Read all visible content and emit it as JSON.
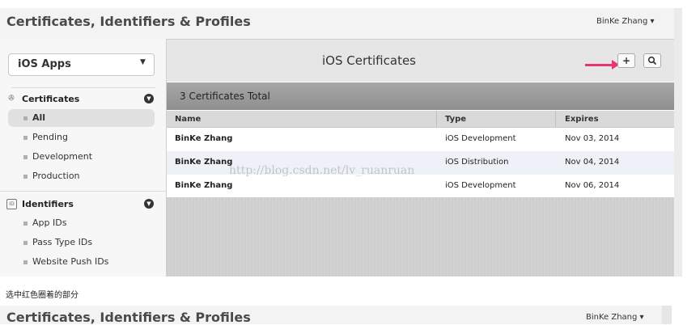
{
  "app": {
    "title": "Certificates, Identifiers & Profiles",
    "user_menu": "BinKe Zhang ▾"
  },
  "sidebar": {
    "platform_select": {
      "selected": "iOS Apps"
    },
    "sections": [
      {
        "title": "Certificates",
        "items": [
          "All",
          "Pending",
          "Development",
          "Production"
        ],
        "active": "All"
      },
      {
        "title": "Identifiers",
        "items": [
          "App IDs",
          "Pass Type IDs",
          "Website Push IDs"
        ]
      }
    ]
  },
  "main": {
    "title": "iOS Certificates",
    "add_button": "+",
    "search_button": "search-icon",
    "total": "3 Certificates Total",
    "columns": [
      "Name",
      "Type",
      "Expires"
    ],
    "rows": [
      {
        "name": "BinKe Zhang",
        "type": "iOS Development",
        "expires": "Nov 03, 2014"
      },
      {
        "name": "BinKe Zhang",
        "type": "iOS Distribution",
        "expires": "Nov 04, 2014"
      },
      {
        "name": "BinKe Zhang",
        "type": "iOS Development",
        "expires": "Nov 06, 2014"
      }
    ]
  },
  "watermark": "http://blog.csdn.net/lv_ruanruan",
  "caption": "选中红色圈着的部分",
  "colors": {
    "arrow": "#e8356a",
    "row_alt": "#eef2f8",
    "accent_text": "#333333"
  }
}
